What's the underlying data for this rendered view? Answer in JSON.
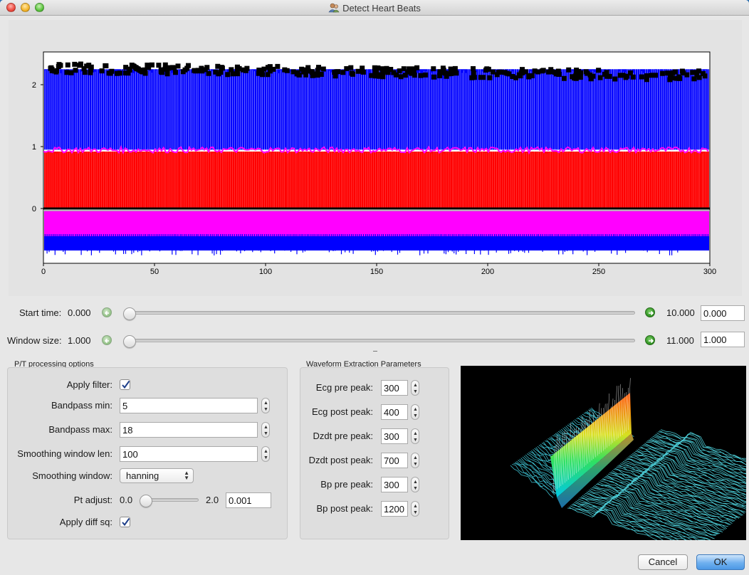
{
  "window": {
    "title": "Detect Heart Beats"
  },
  "plot": {
    "y_ticks": [
      "2",
      "1",
      "0"
    ],
    "x_ticks": [
      "0",
      "50",
      "100",
      "150",
      "200",
      "250",
      "300"
    ],
    "colors": {
      "upper": "#0000ff",
      "middle": "#ff0000",
      "lower": "#ff00ff",
      "markers": "#000000"
    }
  },
  "start_time": {
    "label": "Start time:",
    "min": "0.000",
    "max": "10.000",
    "value": "0.000",
    "fraction": 0.0
  },
  "window_size": {
    "label": "Window size:",
    "min": "1.000",
    "max": "11.000",
    "value": "1.000",
    "fraction": 0.0
  },
  "pt_options": {
    "title": "P/T processing options",
    "apply_filter_label": "Apply filter:",
    "apply_filter": true,
    "bandpass_min_label": "Bandpass min:",
    "bandpass_min": "5",
    "bandpass_max_label": "Bandpass max:",
    "bandpass_max": "18",
    "smoothing_len_label": "Smoothing window len:",
    "smoothing_len": "100",
    "smoothing_window_label": "Smoothing window:",
    "smoothing_window": "hanning",
    "pt_adjust_label": "Pt adjust:",
    "pt_adjust_min": "0.0",
    "pt_adjust_max": "2.0",
    "pt_adjust_value": "0.001",
    "apply_diff_sq_label": "Apply diff sq:",
    "apply_diff_sq": true
  },
  "waveform": {
    "title": "Waveform Extraction Parameters",
    "params": [
      {
        "label": "Ecg pre peak:",
        "value": "300"
      },
      {
        "label": "Ecg post peak:",
        "value": "400"
      },
      {
        "label": "Dzdt pre peak:",
        "value": "300"
      },
      {
        "label": "Dzdt post peak:",
        "value": "700"
      },
      {
        "label": "Bp pre peak:",
        "value": "300"
      },
      {
        "label": "Bp post peak:",
        "value": "1200"
      }
    ]
  },
  "buttons": {
    "cancel": "Cancel",
    "ok": "OK"
  }
}
